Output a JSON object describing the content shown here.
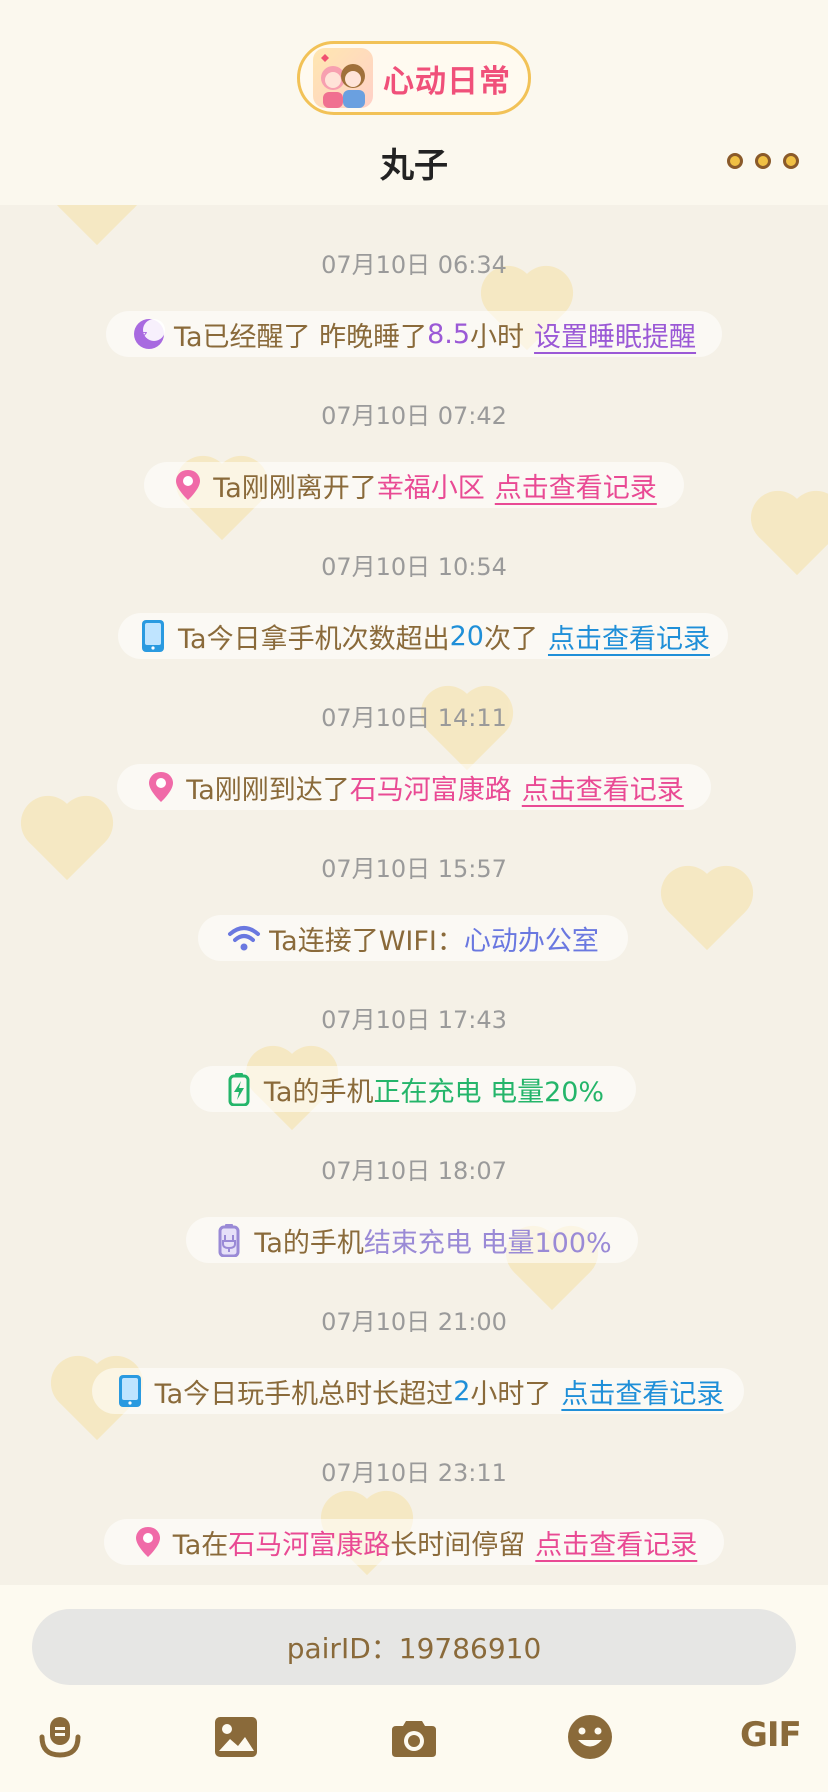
{
  "header": {
    "app_name": "心动日常",
    "title": "丸子",
    "more_icon": "more-dots-icon"
  },
  "messages": [
    {
      "time": "07月10日 06:34",
      "icon": "sleep-moon-icon",
      "parts": [
        {
          "t": "Ta已经醒了 昨晚睡了",
          "c": "brown"
        },
        {
          "t": "8.5",
          "c": "purple"
        },
        {
          "t": "小时",
          "c": "brown"
        }
      ],
      "link": "设置睡眠提醒",
      "link_color": "purple"
    },
    {
      "time": "07月10日 07:42",
      "icon": "location-pin-icon",
      "parts": [
        {
          "t": "Ta刚刚离开了",
          "c": "brown"
        },
        {
          "t": "幸福小区",
          "c": "pink"
        }
      ],
      "link": "点击查看记录",
      "link_color": "pink"
    },
    {
      "time": "07月10日 10:54",
      "icon": "phone-icon",
      "parts": [
        {
          "t": "Ta今日拿手机次数超出",
          "c": "brown"
        },
        {
          "t": "20",
          "c": "blue"
        },
        {
          "t": "次了",
          "c": "brown"
        }
      ],
      "link": "点击查看记录",
      "link_color": "blue"
    },
    {
      "time": "07月10日 14:11",
      "icon": "location-pin-icon",
      "parts": [
        {
          "t": "Ta刚刚到达了",
          "c": "brown"
        },
        {
          "t": "石马河富康路",
          "c": "pink"
        }
      ],
      "link": "点击查看记录",
      "link_color": "pink"
    },
    {
      "time": "07月10日 15:57",
      "icon": "wifi-icon",
      "parts": [
        {
          "t": "Ta连接了WIFI：",
          "c": "brown"
        },
        {
          "t": "心动办公室",
          "c": "periw"
        }
      ],
      "link": "",
      "link_color": ""
    },
    {
      "time": "07月10日 17:43",
      "icon": "battery-charging-icon",
      "parts": [
        {
          "t": "Ta的手机",
          "c": "brown"
        },
        {
          "t": "正在充电 电量20%",
          "c": "green"
        }
      ],
      "link": "",
      "link_color": ""
    },
    {
      "time": "07月10日 18:07",
      "icon": "battery-unplug-icon",
      "parts": [
        {
          "t": "Ta的手机",
          "c": "brown"
        },
        {
          "t": "结束充电 电量100%",
          "c": "lav"
        }
      ],
      "link": "",
      "link_color": ""
    },
    {
      "time": "07月10日 21:00",
      "icon": "phone-icon",
      "parts": [
        {
          "t": "Ta今日玩手机总时长超过",
          "c": "brown"
        },
        {
          "t": "2",
          "c": "blue"
        },
        {
          "t": "小时了",
          "c": "brown"
        }
      ],
      "link": "点击查看记录",
      "link_color": "blue"
    },
    {
      "time": "07月10日 23:11",
      "icon": "location-pin-icon",
      "parts": [
        {
          "t": "Ta在",
          "c": "brown"
        },
        {
          "t": "石马河富康路",
          "c": "pink"
        },
        {
          "t": "长时间停留",
          "c": "brown"
        }
      ],
      "link": "点击查看记录",
      "link_color": "pink"
    }
  ],
  "footer": {
    "pair_text": "pairID：19786910",
    "tools": [
      "voice-icon",
      "image-icon",
      "camera-icon",
      "emoji-icon",
      "gif-icon"
    ],
    "gif_label": "GIF"
  },
  "colors": {
    "accent": "#f2c257",
    "brown": "#8a6a3a",
    "pink": "#e94a94",
    "blue": "#1f8fd8"
  }
}
